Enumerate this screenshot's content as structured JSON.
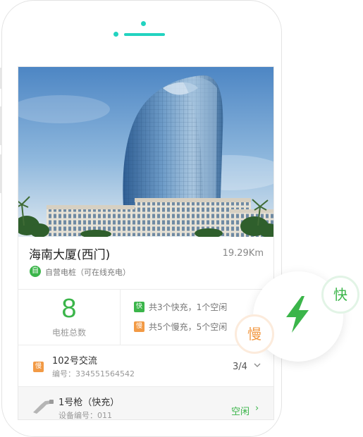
{
  "station": {
    "name": "海南大厦(西门)",
    "distance": "19.29Km",
    "self_badge": "自",
    "self_text": "自营电桩（可在线充电）"
  },
  "stats": {
    "total": "8",
    "total_label": "电桩总数",
    "fast_tag": "快",
    "fast_text": "共3个快充，1个空闲",
    "slow_tag": "慢",
    "slow_text": "共5个慢充，5个空闲"
  },
  "charger": {
    "tag": "慢",
    "name": "102号交流",
    "id_text": "编号：334551564542",
    "count": "3/4"
  },
  "gun": {
    "name": "1号枪（快充）",
    "id_text": "设备编号：011",
    "status": "空闲",
    "chevron": "›"
  },
  "overlay": {
    "fast_label": "快",
    "slow_label": "慢",
    "fast_color": "#3bb54a",
    "slow_color": "#f29a45"
  }
}
